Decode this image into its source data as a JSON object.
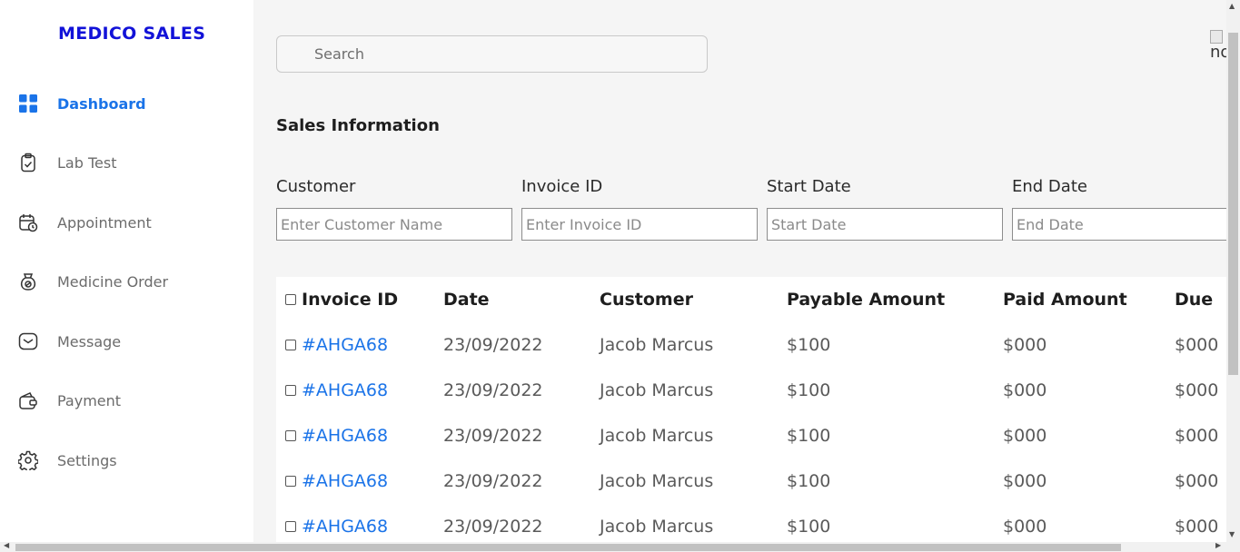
{
  "brand": "MEDICO SALES",
  "nav": [
    {
      "label": "Dashboard",
      "icon": "dashboard-icon",
      "active": true
    },
    {
      "label": "Lab Test",
      "icon": "clipboard-check-icon"
    },
    {
      "label": "Appointment",
      "icon": "calendar-clock-icon"
    },
    {
      "label": "Medicine Order",
      "icon": "medicine-bag-icon"
    },
    {
      "label": "Message",
      "icon": "message-icon"
    },
    {
      "label": "Payment",
      "icon": "wallet-icon"
    },
    {
      "label": "Settings",
      "icon": "gear-icon"
    }
  ],
  "search": {
    "placeholder": "Search"
  },
  "broken_image_alt": "no",
  "section_title": "Sales Information",
  "filters": {
    "customer": {
      "label": "Customer",
      "placeholder": "Enter Customer Name"
    },
    "invoice": {
      "label": "Invoice ID",
      "placeholder": "Enter Invoice ID"
    },
    "start": {
      "label": "Start Date",
      "placeholder": "Start Date"
    },
    "end": {
      "label": "End Date",
      "placeholder": "End Date"
    }
  },
  "table": {
    "headers": [
      "Invoice ID",
      "Date",
      "Customer",
      "Payable Amount",
      "Paid Amount",
      "Due"
    ],
    "rows": [
      [
        "#AHGA68",
        "23/09/2022",
        "Jacob Marcus",
        "$100",
        "$000",
        "$000"
      ],
      [
        "#AHGA68",
        "23/09/2022",
        "Jacob Marcus",
        "$100",
        "$000",
        "$000"
      ],
      [
        "#AHGA68",
        "23/09/2022",
        "Jacob Marcus",
        "$100",
        "$000",
        "$000"
      ],
      [
        "#AHGA68",
        "23/09/2022",
        "Jacob Marcus",
        "$100",
        "$000",
        "$000"
      ],
      [
        "#AHGA68",
        "23/09/2022",
        "Jacob Marcus",
        "$100",
        "$000",
        "$000"
      ]
    ]
  },
  "colors": {
    "brand": "#1212d8",
    "accent": "#1a73e8"
  }
}
